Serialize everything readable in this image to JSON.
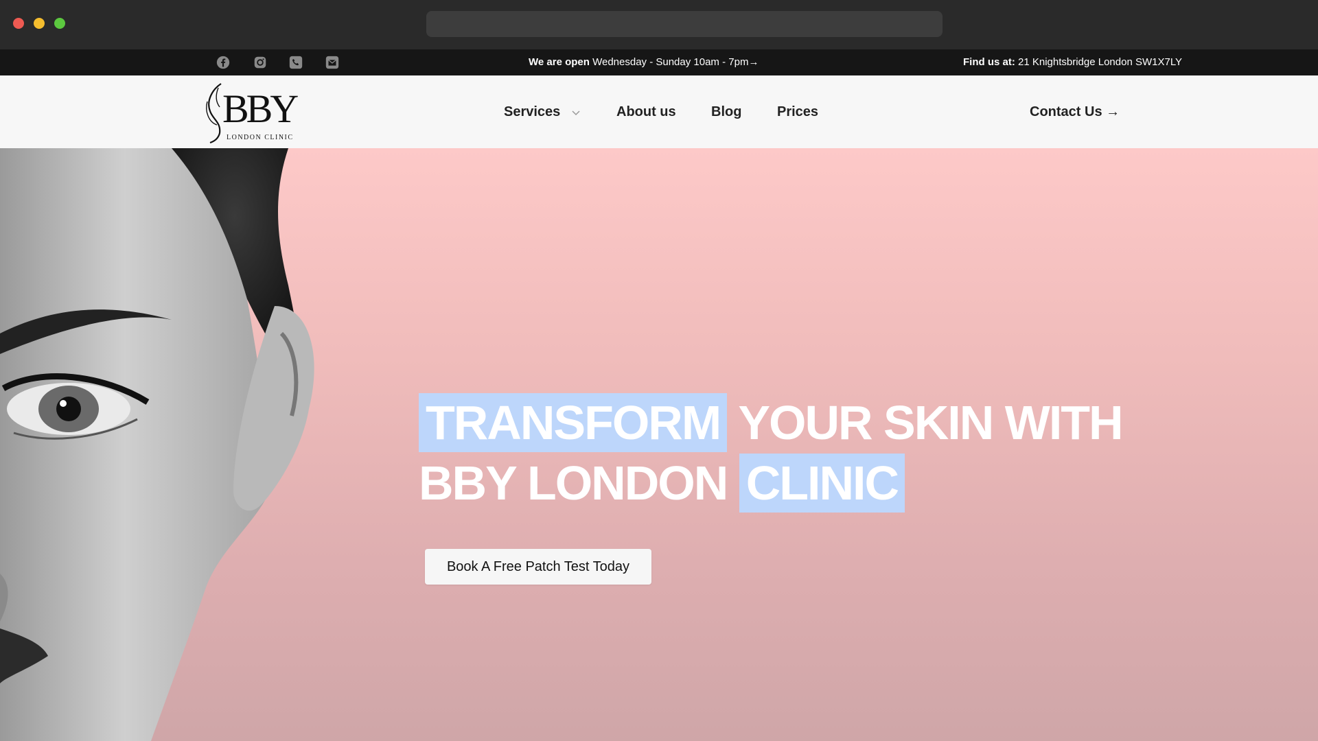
{
  "topbar": {
    "hours_label": "We are open",
    "hours_value": "Wednesday - Sunday 10am - 7pm→",
    "address_label": "Find us at:",
    "address_value": "21 Knightsbridge London SW1X7LY",
    "social_icons": [
      "facebook-icon",
      "instagram-icon",
      "phone-icon",
      "mail-icon"
    ]
  },
  "logo": {
    "text": "BBY",
    "subtext": "LONDON CLINIC"
  },
  "nav": {
    "services": "Services",
    "about": "About us",
    "blog": "Blog",
    "prices": "Prices",
    "contact": "Contact Us →"
  },
  "hero": {
    "headline_highlight_1": "TRANSFORM",
    "headline_middle": " YOUR SKIN WITH BBY LONDON ",
    "headline_highlight_2": "CLINIC",
    "cta": "Book A Free Patch Test Today"
  },
  "colors": {
    "topbar_bg": "#161616",
    "nav_bg": "#f7f7f7",
    "hero_gradient_top": "#fdc9c8",
    "hero_gradient_bottom": "#cfa6a8",
    "highlight": "#bdd6fb"
  }
}
